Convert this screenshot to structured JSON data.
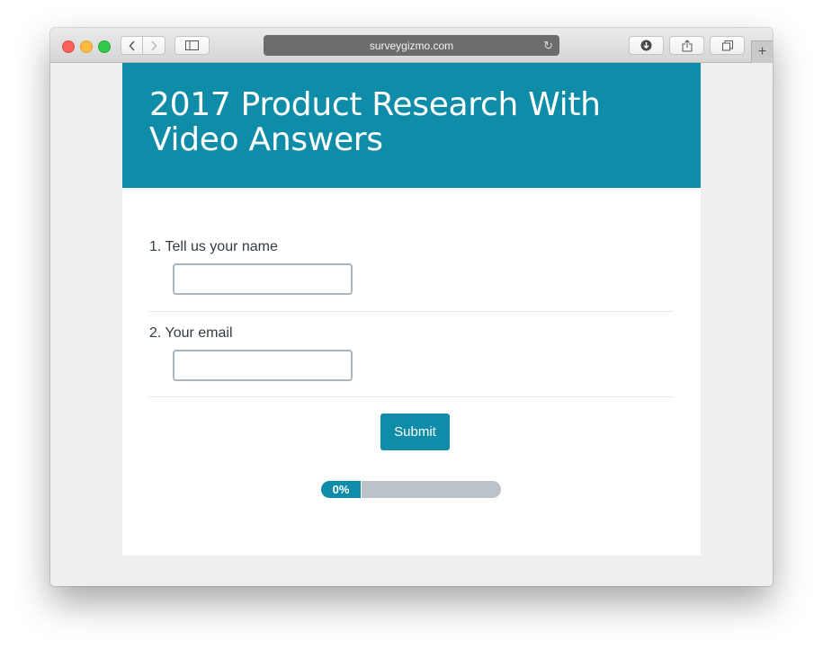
{
  "browser": {
    "url": "surveygizmo.com",
    "icons": {
      "back": "chevron-left-icon",
      "forward": "chevron-right-icon",
      "sidebar": "sidebar-icon",
      "reload": "reload-icon",
      "download": "download-icon",
      "share": "share-icon",
      "tabs": "tabs-icon",
      "new_tab": "plus-icon"
    }
  },
  "survey": {
    "title": "2017 Product Research With Video Answers",
    "questions": [
      {
        "label": "1. Tell us your name",
        "value": ""
      },
      {
        "label": "2. Your email",
        "value": ""
      }
    ],
    "submit_label": "Submit",
    "progress": {
      "percent": 0,
      "label": "0%"
    }
  },
  "colors": {
    "accent": "#0f8ca8",
    "page_background": "#efefef",
    "progress_track": "#bcc3c8"
  }
}
